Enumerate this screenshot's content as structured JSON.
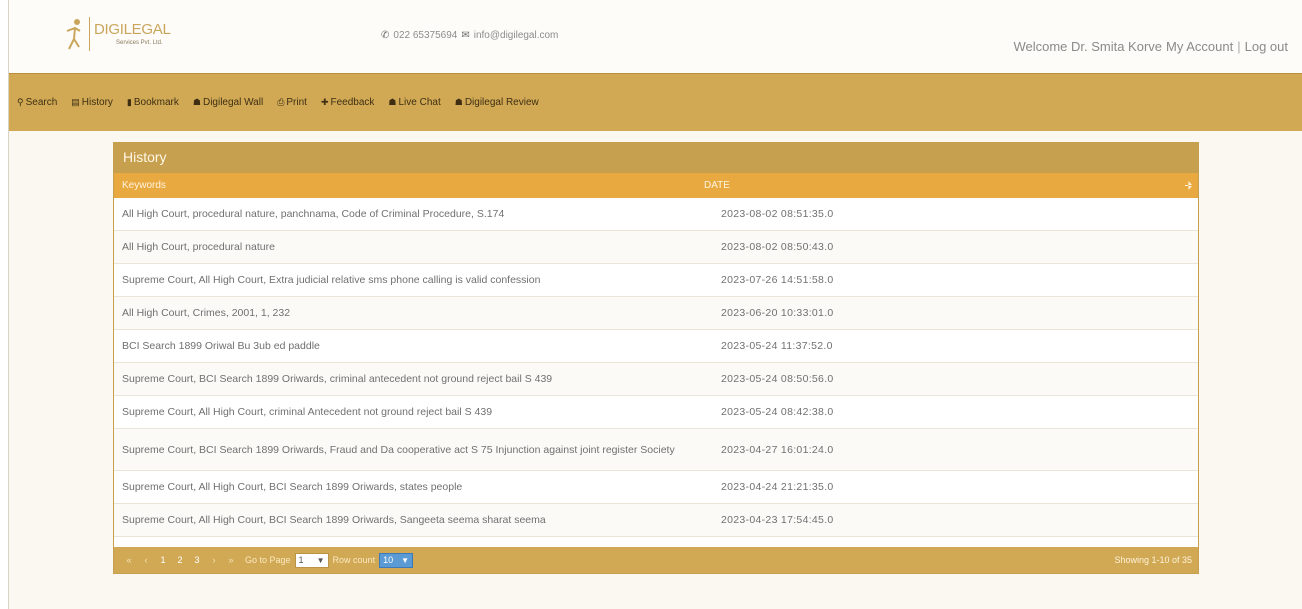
{
  "header": {
    "logo_name": "DIGILEGAL",
    "logo_sub": "Services Pvt. Ltd.",
    "phone": "022 65375694",
    "email": "info@digilegal.com",
    "welcome": "Welcome Dr. Smita Korve",
    "my_account": "My Account",
    "separator": "|",
    "logout": "Log out"
  },
  "nav": [
    {
      "label": "Search",
      "icon": "search-icon",
      "glyph": "⚲"
    },
    {
      "label": "History",
      "icon": "history-icon",
      "glyph": "▤"
    },
    {
      "label": "Bookmark",
      "icon": "bookmark-icon",
      "glyph": "▮"
    },
    {
      "label": "Digilegal Wall",
      "icon": "wall-icon",
      "glyph": "☗"
    },
    {
      "label": "Print",
      "icon": "print-icon",
      "glyph": "⎙"
    },
    {
      "label": "Feedback",
      "icon": "feedback-icon",
      "glyph": "✚"
    },
    {
      "label": "Live Chat",
      "icon": "chat-icon",
      "glyph": "☗"
    },
    {
      "label": "Digilegal Review",
      "icon": "review-icon",
      "glyph": "☗"
    }
  ],
  "panel": {
    "title": "History",
    "columns": [
      "Keywords",
      "DATE"
    ]
  },
  "rows": [
    {
      "keywords": "All High Court, procedural nature, panchnama, Code of Criminal Procedure, S.174",
      "date": "2023-08-02 08:51:35.0"
    },
    {
      "keywords": "All High Court, procedural nature",
      "date": "2023-08-02 08:50:43.0"
    },
    {
      "keywords": "Supreme Court, All High Court, Extra judicial relative sms phone calling is valid confession",
      "date": "2023-07-26 14:51:58.0"
    },
    {
      "keywords": "All High Court, Crimes, 2001, 1, 232",
      "date": "2023-06-20 10:33:01.0"
    },
    {
      "keywords": "BCI Search 1899 Oriwal Bu 3ub ed paddle",
      "date": "2023-05-24 11:37:52.0"
    },
    {
      "keywords": "Supreme Court, BCI Search 1899 Oriwards, criminal antecedent not ground reject bail S 439",
      "date": "2023-05-24 08:50:56.0"
    },
    {
      "keywords": "Supreme Court, All High Court, criminal Antecedent not ground reject bail S 439",
      "date": "2023-05-24 08:42:38.0"
    },
    {
      "keywords": "Supreme Court, BCI Search 1899 Oriwards, Fraud and Da cooperative act S 75 Injunction against joint register Society",
      "date": "2023-04-27 16:01:24.0",
      "tall": true
    },
    {
      "keywords": "Supreme Court, All High Court, BCI Search 1899 Oriwards, states people",
      "date": "2023-04-24 21:21:35.0"
    },
    {
      "keywords": "Supreme Court, All High Court, BCI Search 1899 Oriwards, Sangeeta seema sharat seema",
      "date": "2023-04-23 17:54:45.0"
    }
  ],
  "pager": {
    "buttons": [
      "«",
      "‹",
      "1",
      "2",
      "3",
      "›",
      "»"
    ],
    "goto_label": "Go to Page",
    "page_value": "1",
    "rowcount_label": "Row count",
    "rowcount_value": "10",
    "showing": "Showing 1-10 of 35"
  },
  "colors": {
    "nav_bg": "#d1a955",
    "panel_title_bg": "#c7a04f",
    "column_header_bg": "#e9a941",
    "logo": "#c9a65c"
  }
}
